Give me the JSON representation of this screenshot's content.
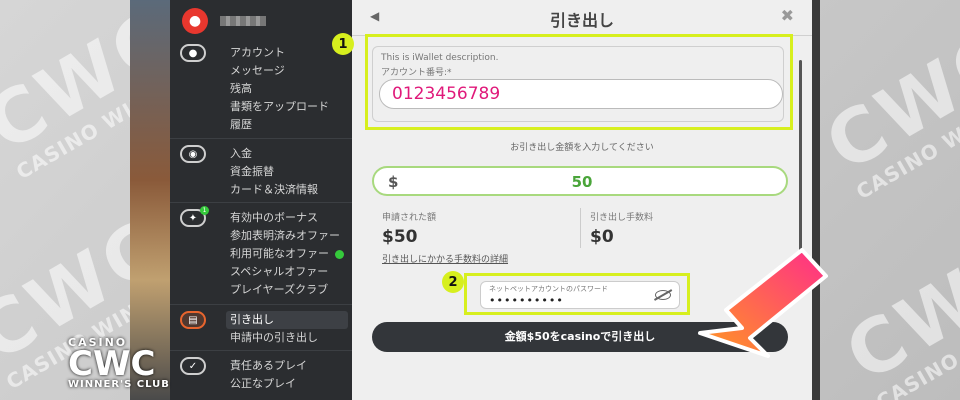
{
  "watermark": {
    "big": "CWC",
    "small": "CASINO WINNER'S CLUB"
  },
  "corner_logo": {
    "top": "CASINO",
    "mid": "CWC",
    "bottom": "WINNER'S CLUB"
  },
  "sidebar": {
    "groups": [
      {
        "icon": "person-icon",
        "items": [
          "アカウント",
          "メッセージ",
          "残高",
          "書類をアップロード",
          "履歴"
        ]
      },
      {
        "icon": "coins-icon",
        "items": [
          "入金",
          "資金振替",
          "カード＆決済情報"
        ]
      },
      {
        "icon": "gift-icon",
        "badge": "1",
        "items": [
          "有効中のボーナス",
          "参加表明済みオファー",
          "利用可能なオファー",
          "スペシャルオファー",
          "プレイヤーズクラブ"
        ]
      },
      {
        "icon": "withdraw-icon",
        "items": [
          "引き出し",
          "申請中の引き出し"
        ]
      },
      {
        "icon": "shield-icon",
        "items": [
          "責任あるプレイ",
          "公正なプレイ"
        ]
      }
    ]
  },
  "modal": {
    "title": "引き出し",
    "wallet_description": "This is iWallet description.",
    "account_label": "アカウント番号:*",
    "account_value": "0123456789",
    "amount_hint": "お引き出し金額を入力してください",
    "currency_symbol": "$",
    "amount_value": "50",
    "requested_label": "申請された額",
    "requested_value": "$50",
    "fee_label": "引き出し手数料",
    "fee_value": "$0",
    "fee_link": "引き出しにかかる手数料の詳細",
    "password_label": "ネットペットアカウントのパスワード",
    "password_value": "••••••••••",
    "submit_label": "金額$50をcasinoで引き出し"
  },
  "callouts": {
    "one": "1",
    "two": "2"
  },
  "colors": {
    "highlight": "#d7ef1e",
    "accent": "#e8372e",
    "amount_green": "#4aa53a",
    "account_pink": "#e0197a"
  }
}
